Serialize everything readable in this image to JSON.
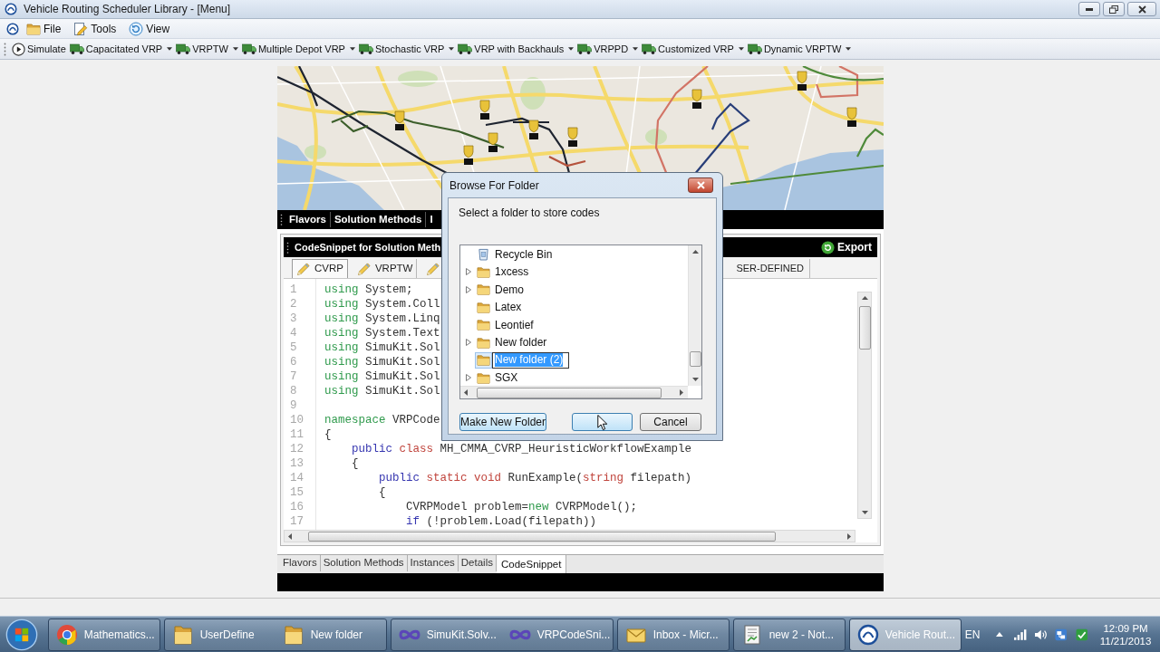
{
  "window": {
    "title": "Vehicle Routing Scheduler Library - [Menu]"
  },
  "menu": [
    {
      "label": "File",
      "kind": "file"
    },
    {
      "label": "Tools",
      "kind": "tools"
    },
    {
      "label": "View",
      "kind": "view"
    }
  ],
  "toolbar": [
    {
      "label": "Simulate",
      "kind": "action"
    },
    {
      "label": "Capacitated VRP",
      "kind": "dropdown"
    },
    {
      "label": "VRPTW",
      "kind": "dropdown"
    },
    {
      "label": "Multiple Depot VRP",
      "kind": "dropdown"
    },
    {
      "label": "Stochastic VRP",
      "kind": "dropdown"
    },
    {
      "label": "VRP with Backhauls",
      "kind": "dropdown"
    },
    {
      "label": "VRPPD",
      "kind": "dropdown"
    },
    {
      "label": "Customized VRP",
      "kind": "dropdown"
    },
    {
      "label": "Dynamic VRPTW",
      "kind": "dropdown"
    }
  ],
  "top_tabs": [
    "Flavors",
    "Solution Methods",
    "I"
  ],
  "snippet_panel": {
    "title": "CodeSnippet for Solution Meth",
    "export_label": "Export",
    "tabs": [
      {
        "label": "CVRP",
        "selected": true
      },
      {
        "label": "VRPTW",
        "selected": false
      },
      {
        "selected": false
      },
      {
        "label": "SER-DEFINED",
        "selected": false
      }
    ],
    "code_lines": [
      {
        "number": "1",
        "tokens": [
          {
            "text": "using",
            "color": "#2f9a4c"
          },
          {
            "text": " System;"
          }
        ]
      },
      {
        "number": "2",
        "tokens": [
          {
            "text": "using",
            "color": "#2f9a4c"
          },
          {
            "text": " System.Coll"
          }
        ]
      },
      {
        "number": "3",
        "tokens": [
          {
            "text": "using",
            "color": "#2f9a4c"
          },
          {
            "text": " System.Linq"
          }
        ]
      },
      {
        "number": "4",
        "tokens": [
          {
            "text": "using",
            "color": "#2f9a4c"
          },
          {
            "text": " System.Text"
          }
        ]
      },
      {
        "number": "5",
        "tokens": [
          {
            "text": "using",
            "color": "#2f9a4c"
          },
          {
            "text": " SimuKit.Sol"
          }
        ]
      },
      {
        "number": "6",
        "tokens": [
          {
            "text": "using",
            "color": "#2f9a4c"
          },
          {
            "text": " SimuKit.Sol"
          }
        ]
      },
      {
        "number": "7",
        "tokens": [
          {
            "text": "using",
            "color": "#2f9a4c"
          },
          {
            "text": " SimuKit.Sol"
          }
        ]
      },
      {
        "number": "8",
        "tokens": [
          {
            "text": "using",
            "color": "#2f9a4c"
          },
          {
            "text": " SimuKit.Sol"
          }
        ]
      },
      {
        "number": "9"
      },
      {
        "number": "10",
        "tokens": [
          {
            "text": "namespace",
            "color": "#2f9a4c"
          },
          {
            "text": " VRPCode"
          }
        ]
      },
      {
        "number": "11",
        "tokens": [
          {
            "text": "{"
          }
        ]
      },
      {
        "number": "12",
        "tokens": [
          {
            "text": "    public",
            "color": "#3636b0"
          },
          {
            "text": " class",
            "color": "#c0443c"
          },
          {
            "text": " MH_CMMA_CVRP_HeuristicWorkflowExample"
          }
        ]
      },
      {
        "number": "13",
        "tokens": [
          {
            "text": "    {"
          }
        ]
      },
      {
        "number": "14",
        "tokens": [
          {
            "text": "        public",
            "color": "#3636b0"
          },
          {
            "text": " static void",
            "color": "#c0443c"
          },
          {
            "text": " RunExample("
          },
          {
            "text": "string",
            "color": "#c0443c"
          },
          {
            "text": " filepath)"
          }
        ]
      },
      {
        "number": "15",
        "tokens": [
          {
            "text": "        {"
          }
        ]
      },
      {
        "number": "16",
        "tokens": [
          {
            "text": "            CVRPModel problem="
          },
          {
            "text": "new",
            "color": "#2f9a4c"
          },
          {
            "text": " CVRPModel();"
          }
        ]
      },
      {
        "number": "17",
        "tokens": [
          {
            "text": "            if",
            "color": "#3636b0"
          },
          {
            "text": " (!problem.Load(filepath))"
          }
        ]
      }
    ]
  },
  "bottom_tabs": [
    {
      "label": "Flavors",
      "selected": false
    },
    {
      "label": "Solution Methods",
      "selected": false
    },
    {
      "label": "Instances",
      "selected": false
    },
    {
      "label": "Details",
      "selected": false
    },
    {
      "label": "CodeSnippet",
      "selected": true
    }
  ],
  "dialog": {
    "title": "Browse For Folder",
    "prompt": "Select a folder to store codes",
    "tree": [
      {
        "label": "Recycle Bin",
        "kind": "recycle_bin",
        "expandable": false,
        "selected": false
      },
      {
        "label": "1xcess",
        "kind": "folder",
        "expandable": true,
        "selected": false
      },
      {
        "label": "Demo",
        "kind": "folder",
        "expandable": true,
        "selected": false
      },
      {
        "label": "Latex",
        "kind": "folder",
        "expandable": false,
        "selected": false
      },
      {
        "label": "Leontief",
        "kind": "folder",
        "expandable": false,
        "selected": false
      },
      {
        "label": "New folder",
        "kind": "folder",
        "expandable": true,
        "selected": false
      },
      {
        "label": "New folder (2)",
        "kind": "folder",
        "expandable": false,
        "selected": true
      },
      {
        "label": "SGX",
        "kind": "folder",
        "expandable": true,
        "selected": false
      }
    ],
    "buttons": [
      {
        "label": "Make New Folder",
        "highlighted": true,
        "pointer_over": false
      },
      {
        "highlighted": true,
        "pointer_over": true
      },
      {
        "label": "Cancel",
        "highlighted": false,
        "pointer_over": false
      }
    ]
  },
  "taskbar": {
    "groups": [
      {
        "kind": "browser",
        "windows": [
          {
            "label": "Mathematics...",
            "active": false
          }
        ]
      },
      {
        "kind": "folder",
        "windows": [
          {
            "label": "UserDefine",
            "active": false
          },
          {
            "label": "New folder",
            "active": false
          }
        ]
      },
      {
        "kind": "studio",
        "windows": [
          {
            "label": "SimuKit.Solv...",
            "active": false
          },
          {
            "label": "VRPCodeSni...",
            "active": false
          }
        ]
      },
      {
        "kind": "mail",
        "windows": [
          {
            "label": "Inbox - Micr...",
            "active": false
          }
        ]
      },
      {
        "kind": "editor",
        "windows": [
          {
            "label": "new 2 - Not...",
            "active": false
          }
        ]
      },
      {
        "kind": "app",
        "windows": [
          {
            "label": "Vehicle Rout...",
            "active": true
          }
        ]
      }
    ],
    "language": "EN",
    "time": "12:09 PM",
    "date": "11/21/2013"
  }
}
